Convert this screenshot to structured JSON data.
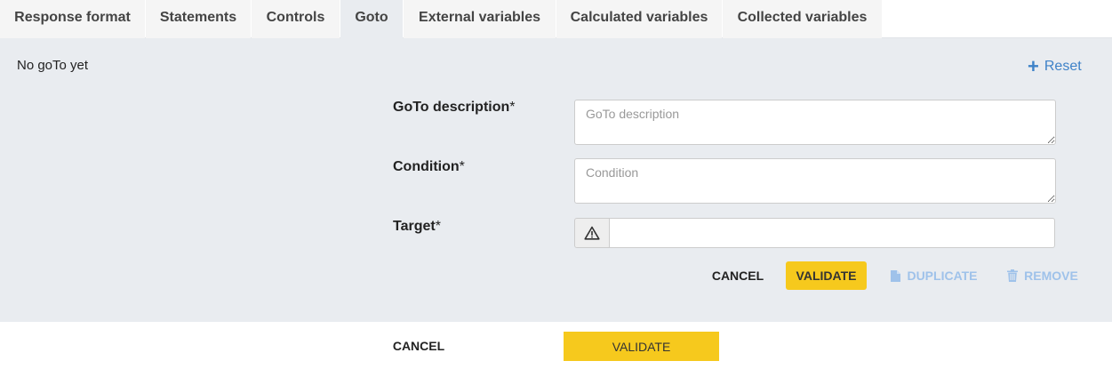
{
  "tabs": [
    {
      "label": "Response format"
    },
    {
      "label": "Statements"
    },
    {
      "label": "Controls"
    },
    {
      "label": "Goto",
      "active": true
    },
    {
      "label": "External variables"
    },
    {
      "label": "Calculated variables"
    },
    {
      "label": "Collected variables"
    }
  ],
  "panel": {
    "empty_message": "No goTo yet",
    "reset_label": "Reset",
    "reset_icon": "plus-icon"
  },
  "form": {
    "description": {
      "label": "GoTo description",
      "required_mark": "*",
      "placeholder": "GoTo description",
      "value": ""
    },
    "condition": {
      "label": "Condition",
      "required_mark": "*",
      "placeholder": "Condition",
      "value": ""
    },
    "target": {
      "label": "Target",
      "required_mark": "*",
      "value": "",
      "addon_icon": "warning-triangle-icon"
    }
  },
  "actions": {
    "cancel": "CANCEL",
    "validate": "VALIDATE",
    "duplicate": "DUPLICATE",
    "duplicate_icon": "file-icon",
    "remove": "REMOVE",
    "remove_icon": "trash-icon"
  },
  "footer": {
    "cancel": "CANCEL",
    "validate": "VALIDATE"
  },
  "colors": {
    "accent_yellow": "#f6c91d",
    "link_blue": "#3e82c8",
    "disabled_blue": "#9fc2ea",
    "panel_bg": "#e9ecf0"
  }
}
